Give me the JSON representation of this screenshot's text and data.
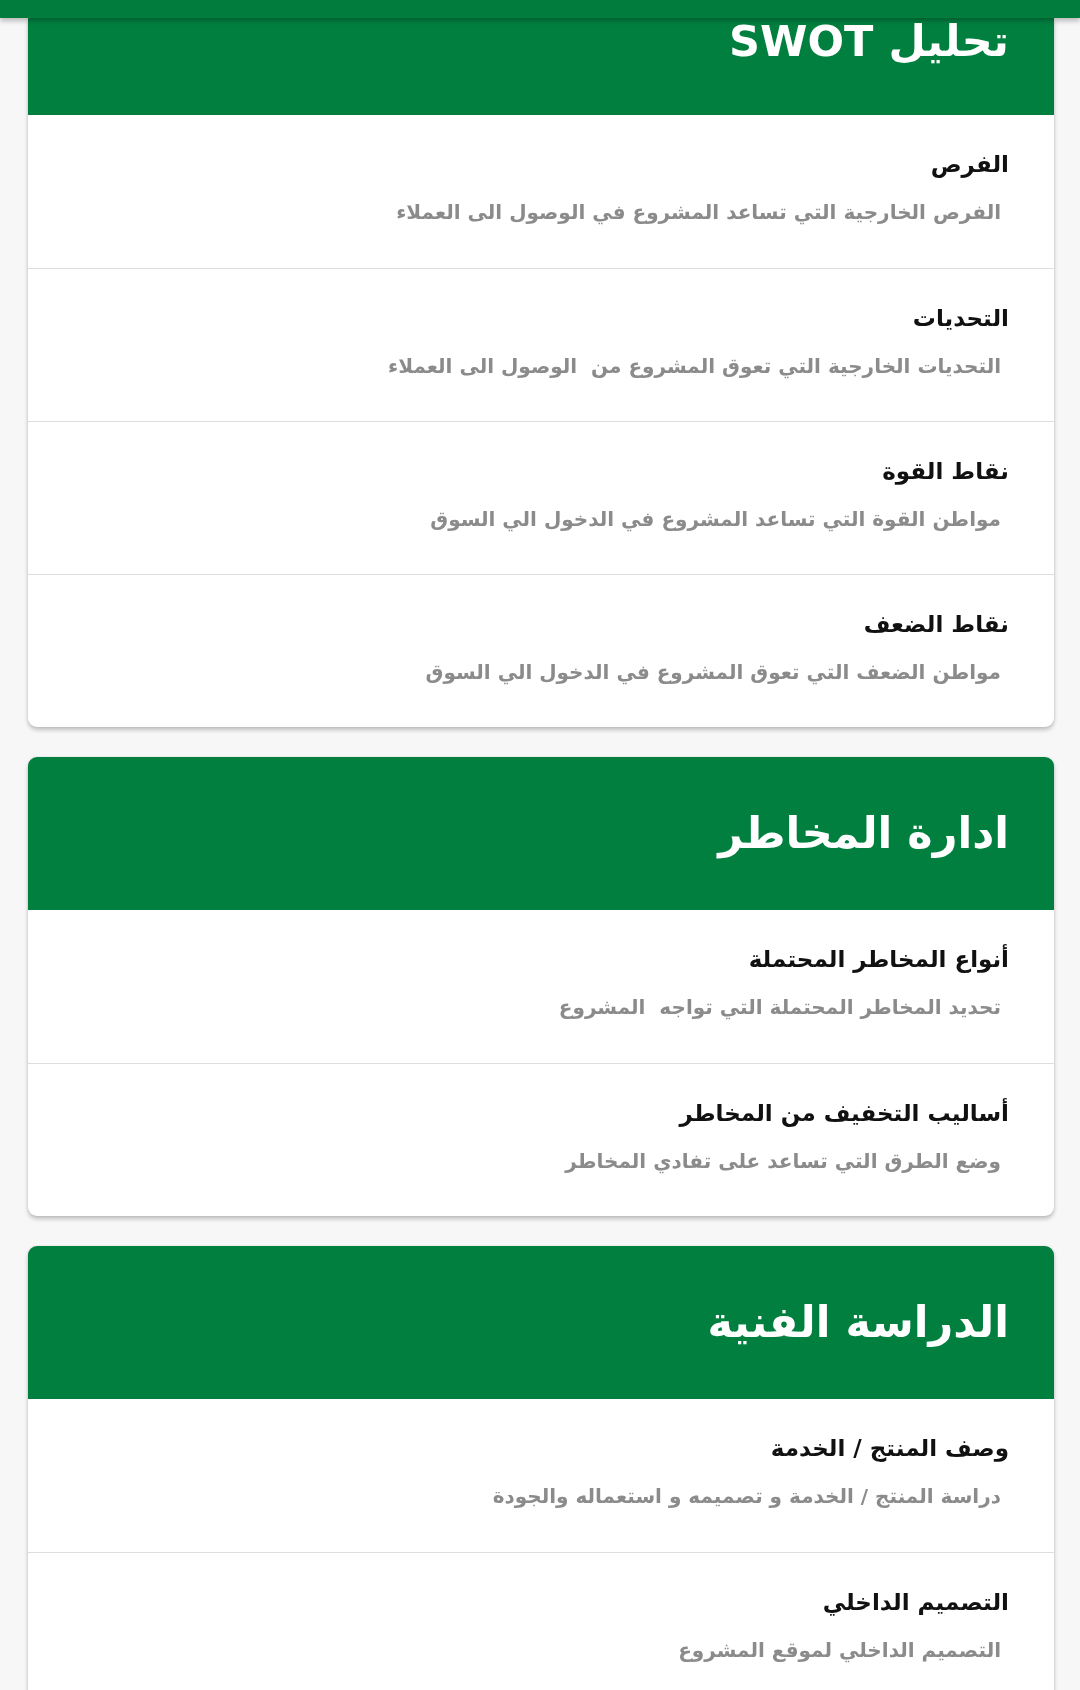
{
  "sections": [
    {
      "title": "تحليل SWOT",
      "items": [
        {
          "title": "الفرص",
          "description": "الفرص الخارجية التي تساعد المشروع في الوصول الى العملاء"
        },
        {
          "title": "التحديات",
          "description": "التحديات الخارجية التي تعوق المشروع من  الوصول الى العملاء"
        },
        {
          "title": "نقاط القوة",
          "description": "مواطن القوة التي تساعد المشروع في الدخول الي السوق"
        },
        {
          "title": "نقاط الضعف",
          "description": "مواطن الضعف التي تعوق المشروع في الدخول الي السوق"
        }
      ]
    },
    {
      "title": "ادارة المخاطر",
      "items": [
        {
          "title": "أنواع المخاطر المحتملة",
          "description": "تحديد المخاطر المحتملة التي تواجه  المشروع"
        },
        {
          "title": "أساليب التخفيف من المخاطر",
          "description": "وضع الطرق التي تساعد على تفادي المخاطر"
        }
      ]
    },
    {
      "title": "الدراسة الفنية",
      "items": [
        {
          "title": "وصف المنتج / الخدمة",
          "description": "دراسة المنتج / الخدمة و تصميمه و استعماله والجودة"
        },
        {
          "title": "التصميم الداخلي",
          "description": "التصميم الداخلي لموقع المشروع"
        }
      ]
    }
  ]
}
